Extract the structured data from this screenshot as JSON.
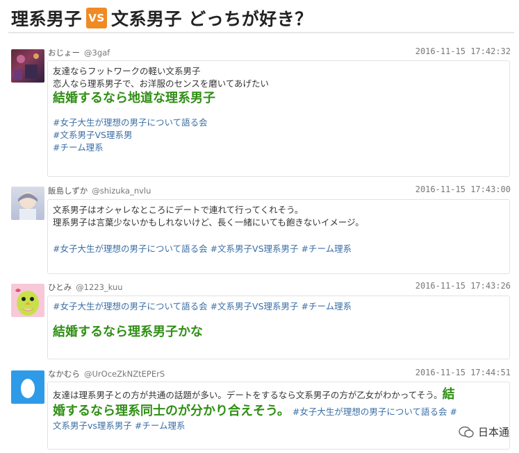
{
  "header": {
    "title_left": "理系男子",
    "vs": "VS",
    "title_right": "文系男子 どっちが好き？"
  },
  "posts": [
    {
      "name": "おじょー",
      "handle": "@3gaf",
      "time": "2016-11-15 17:42:32",
      "avatar_icon": "party-photo",
      "text1": "友達ならフットワークの軽い文系男子",
      "text2": "恋人なら理系男子で、お洋服のセンスを磨いてあげたい",
      "big": "結婚するなら地道な理系男子",
      "tags": [
        "#女子大生が理想の男子について語る会",
        "#文系男子VS理系男",
        "#チーム理系"
      ]
    },
    {
      "name": "飯島しずか",
      "handle": "@shizuka_nvlu",
      "time": "2016-11-15 17:43:00",
      "avatar_icon": "anime-character",
      "text1": "文系男子はオシャレなところにデートで連れて行ってくれそう。",
      "text2": "理系男子は言葉少ないかもしれないけど、長く一緒にいても飽きないイメージ。",
      "tags_line": "#女子大生が理想の男子について語る会 #文系男子VS理系男子 #チーム理系"
    },
    {
      "name": "ひとみ",
      "handle": "@1223_kuu",
      "time": "2016-11-15 17:43:26",
      "avatar_icon": "bird-icon",
      "tags_line": "#女子大生が理想の男子について語る会 #文系男子VS理系男子 #チーム理系",
      "big": "結婚するなら理系男子かな"
    },
    {
      "name": "なかむら",
      "handle": "@UrOceZkNZtEPErS",
      "time": "2016-11-15 17:44:51",
      "avatar_icon": "egg-icon",
      "text1": "友達は理系男子との方が共通の話題が多い。デートをするなら文系男子の方が乙女がわかってそう。",
      "big1": "結",
      "big2": "婚するなら理系同士のが分かり合えそう。",
      "tag1": "#女子大生が理想の男子について語る会 #",
      "tag2": "文系男子vs理系男子 #チーム理系"
    }
  ],
  "watermark": {
    "label": "日本通"
  }
}
